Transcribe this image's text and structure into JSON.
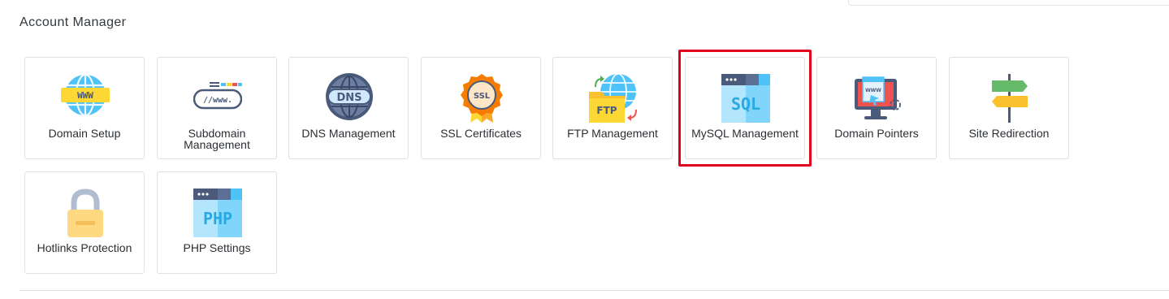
{
  "section": {
    "title": "Account Manager"
  },
  "tiles": [
    {
      "label": "Domain Setup",
      "icon": "www-globe-icon"
    },
    {
      "label": "Subdomain Management",
      "icon": "subdomain-www-icon"
    },
    {
      "label": "DNS Management",
      "icon": "dns-globe-icon"
    },
    {
      "label": "SSL Certificates",
      "icon": "ssl-badge-icon"
    },
    {
      "label": "FTP Management",
      "icon": "ftp-folder-icon"
    },
    {
      "label": "MySQL Management",
      "icon": "sql-window-icon",
      "highlighted": true
    },
    {
      "label": "Domain Pointers",
      "icon": "domain-pointer-monitor-icon"
    },
    {
      "label": "Site Redirection",
      "icon": "signpost-icon"
    },
    {
      "label": "Hotlinks Protection",
      "icon": "padlock-icon"
    },
    {
      "label": "PHP Settings",
      "icon": "php-window-icon"
    }
  ],
  "colors": {
    "highlight": "#e3001b",
    "blue": "#4fc3f7",
    "navy": "#4a5a7a",
    "yellow": "#fdd835",
    "orange": "#f57c00"
  },
  "icon_text": {
    "www": "WWW",
    "dns": "DNS",
    "ssl": "SSL",
    "ftp": "FTP",
    "sql": "SQL",
    "php": "PHP",
    "subdomain": "//www."
  }
}
